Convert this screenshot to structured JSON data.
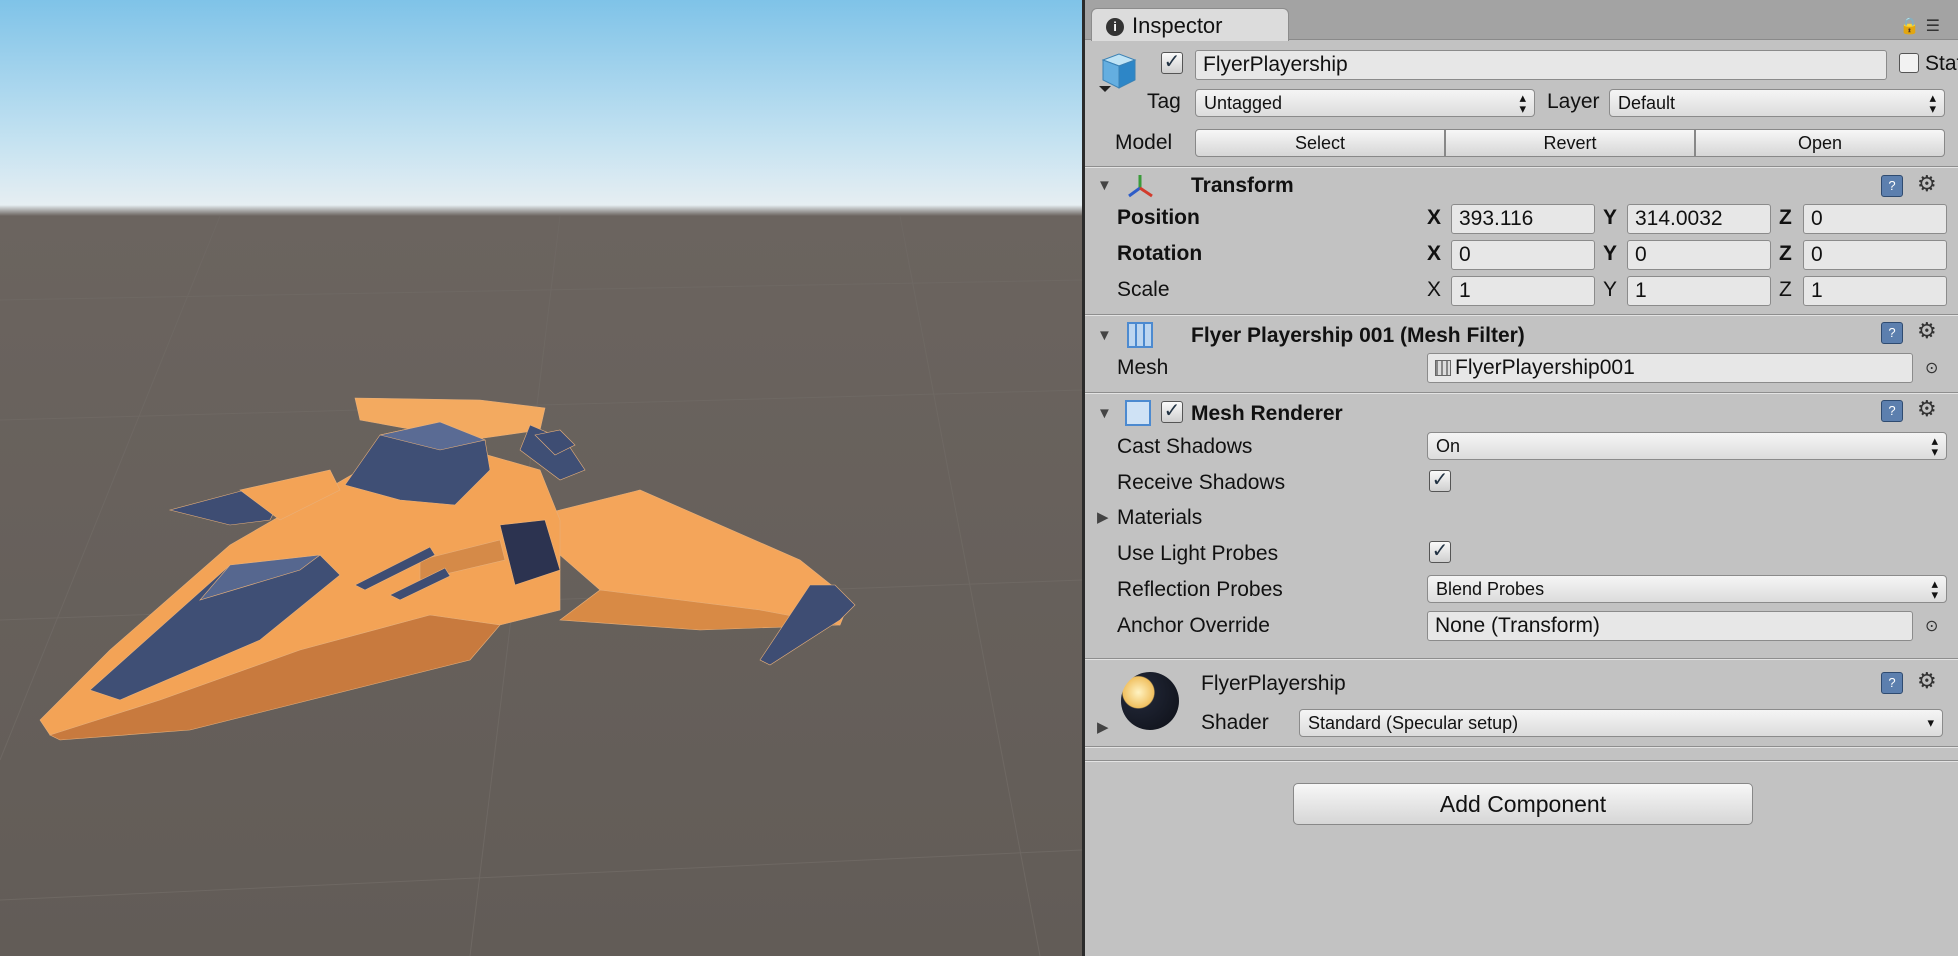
{
  "inspector": {
    "tab_label": "Inspector",
    "object": {
      "name": "FlyerPlayership",
      "active": true,
      "static_label": "Static",
      "static_checked": false,
      "tag_label": "Tag",
      "tag_value": "Untagged",
      "layer_label": "Layer",
      "layer_value": "Default",
      "model_label": "Model",
      "model_buttons": {
        "select": "Select",
        "revert": "Revert",
        "open": "Open"
      }
    },
    "transform": {
      "title": "Transform",
      "position_label": "Position",
      "rotation_label": "Rotation",
      "scale_label": "Scale",
      "axis_x": "X",
      "axis_y": "Y",
      "axis_z": "Z",
      "position": {
        "x": "393.116",
        "y": "314.0032",
        "z": "0"
      },
      "rotation": {
        "x": "0",
        "y": "0",
        "z": "0"
      },
      "scale": {
        "x": "1",
        "y": "1",
        "z": "1"
      }
    },
    "mesh_filter": {
      "title": "Flyer Playership 001 (Mesh Filter)",
      "mesh_label": "Mesh",
      "mesh_value": "FlyerPlayership001"
    },
    "mesh_renderer": {
      "title": "Mesh Renderer",
      "enabled": true,
      "cast_shadows_label": "Cast Shadows",
      "cast_shadows_value": "On",
      "receive_shadows_label": "Receive Shadows",
      "receive_shadows": true,
      "materials_label": "Materials",
      "use_light_probes_label": "Use Light Probes",
      "use_light_probes": true,
      "reflection_probes_label": "Reflection Probes",
      "reflection_probes_value": "Blend Probes",
      "anchor_override_label": "Anchor Override",
      "anchor_override_value": "None (Transform)"
    },
    "material": {
      "name": "FlyerPlayership",
      "shader_label": "Shader",
      "shader_value": "Standard (Specular setup)"
    },
    "add_component_label": "Add Component"
  },
  "colors": {
    "ship_orange": "#f3a356",
    "ship_dark_orange": "#c87a3e",
    "ship_navy": "#3f4f75",
    "inspector_bg": "#c2c2c2"
  }
}
